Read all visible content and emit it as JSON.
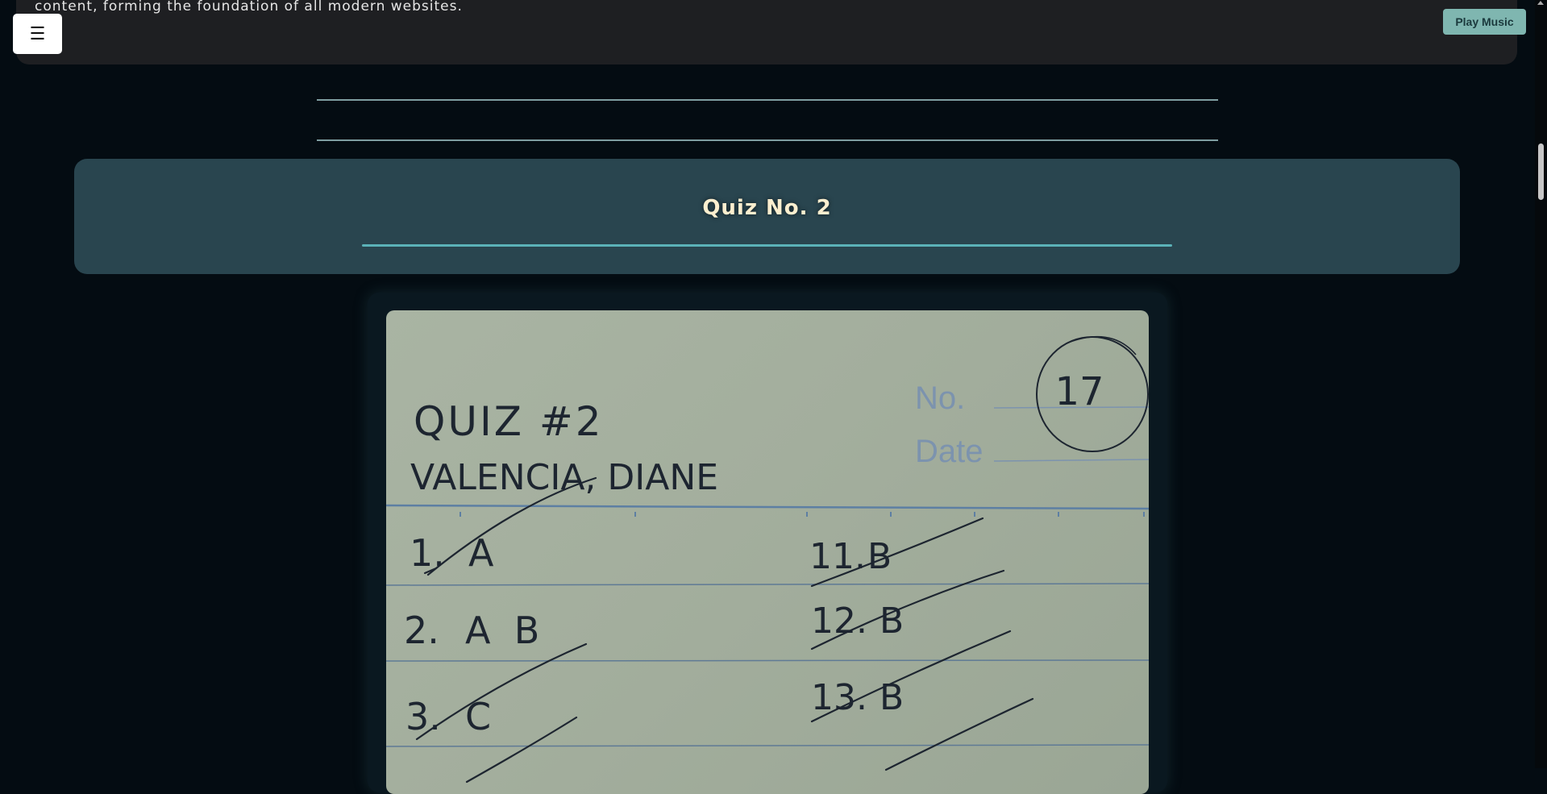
{
  "top_section": {
    "text": "content, forming the foundation of all modern websites."
  },
  "menu_button": {
    "label": "☰"
  },
  "play_music_button": {
    "label": "Play Music"
  },
  "quiz": {
    "title": "Quiz No. 2"
  },
  "quiz_image": {
    "heading": "QUIZ #2",
    "name": "VALENCIA, DIANE",
    "no_label": "No.",
    "date_label": "Date",
    "score": "17",
    "answers_left": [
      {
        "number": "1.",
        "answer": "A"
      },
      {
        "number": "2.",
        "answer": "A  B"
      },
      {
        "number": "3.",
        "answer": "C"
      }
    ],
    "answers_right": [
      {
        "number": "11.",
        "answer": "B"
      },
      {
        "number": "12.",
        "answer": "B"
      },
      {
        "number": "13.",
        "answer": "B"
      }
    ]
  }
}
